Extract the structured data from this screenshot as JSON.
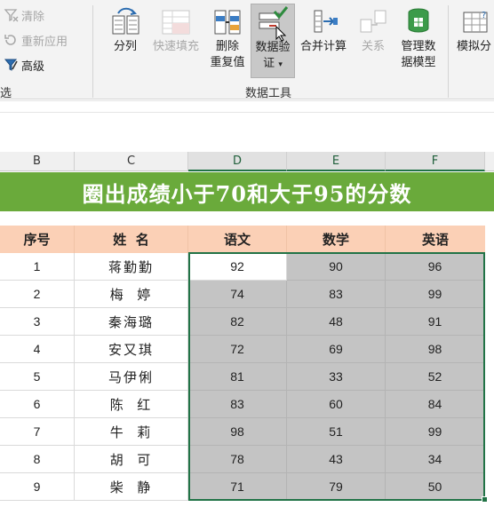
{
  "ribbon": {
    "sort_filter": {
      "clear": "清除",
      "reapply": "重新应用",
      "advanced": "高级",
      "group_label_partial": "选"
    },
    "tools": {
      "split_columns": "分列",
      "flash_fill": "快速填充",
      "remove_duplicates_1": "删除",
      "remove_duplicates_2": "重复值",
      "data_validation_1": "数据验",
      "data_validation_2": "证",
      "data_validation_dropdown": "▾",
      "consolidate": "合并计算",
      "relationships": "关系",
      "data_model_1": "管理数",
      "data_model_2": "据模型",
      "what_if_1": "模拟分",
      "group_label": "数据工具"
    }
  },
  "columns": [
    "B",
    "C",
    "D",
    "E",
    "F"
  ],
  "title": "圈出成绩小于70和大于95的分数",
  "headers": [
    "序号",
    "姓  名",
    "语文",
    "数学",
    "英语"
  ],
  "rows": [
    {
      "no": "1",
      "name": "蒋勤勤",
      "chinese": "92",
      "math": "90",
      "english": "96"
    },
    {
      "no": "2",
      "name": "梅  婷",
      "chinese": "74",
      "math": "83",
      "english": "99"
    },
    {
      "no": "3",
      "name": "秦海璐",
      "chinese": "82",
      "math": "48",
      "english": "91"
    },
    {
      "no": "4",
      "name": "安又琪",
      "chinese": "72",
      "math": "69",
      "english": "98"
    },
    {
      "no": "5",
      "name": "马伊俐",
      "chinese": "81",
      "math": "33",
      "english": "52"
    },
    {
      "no": "6",
      "name": "陈  红",
      "chinese": "83",
      "math": "60",
      "english": "84"
    },
    {
      "no": "7",
      "name": "牛  莉",
      "chinese": "98",
      "math": "51",
      "english": "99"
    },
    {
      "no": "8",
      "name": "胡  可",
      "chinese": "78",
      "math": "43",
      "english": "34"
    },
    {
      "no": "9",
      "name": "柴  静",
      "chinese": "71",
      "math": "79",
      "english": "50"
    }
  ],
  "colors": {
    "accent": "#217346",
    "title_bg": "#6aaa3b",
    "header_bg": "#fbd0b6",
    "selection_fill": "#c4c4c4"
  }
}
